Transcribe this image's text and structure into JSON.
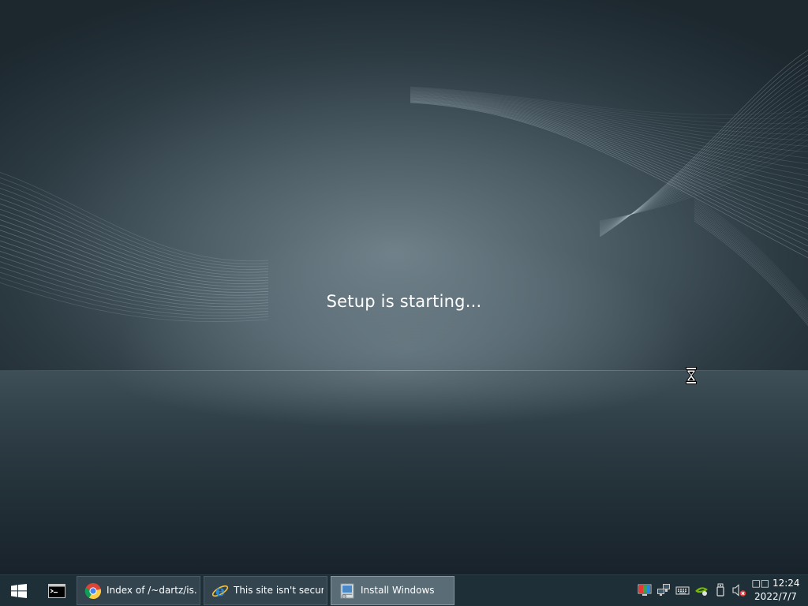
{
  "desktop": {
    "setup_message": "Setup is starting..."
  },
  "taskbar": {
    "start_icon": "windows-logo-icon",
    "pinned": [
      {
        "icon": "command-prompt-icon"
      }
    ],
    "tasks": [
      {
        "label": "Index of /~dartz/is...",
        "icon": "chrome-icon"
      },
      {
        "label": "This site isn't secur...",
        "icon": "internet-explorer-icon"
      },
      {
        "label": "Install Windows",
        "icon": "windows-setup-icon",
        "active": true
      }
    ],
    "tray_icons": [
      "color-display-icon",
      "network-icon",
      "keyboard-icon",
      "nvidia-icon",
      "usb-drive-icon",
      "volume-muted-icon"
    ],
    "clock": {
      "time": "□□ 12:24",
      "date": "2022/7/7"
    }
  },
  "colors": {
    "taskbar_bg": "#1f2f38",
    "active_task_bg": "#5a6c76",
    "task_bg": "#33444e"
  }
}
